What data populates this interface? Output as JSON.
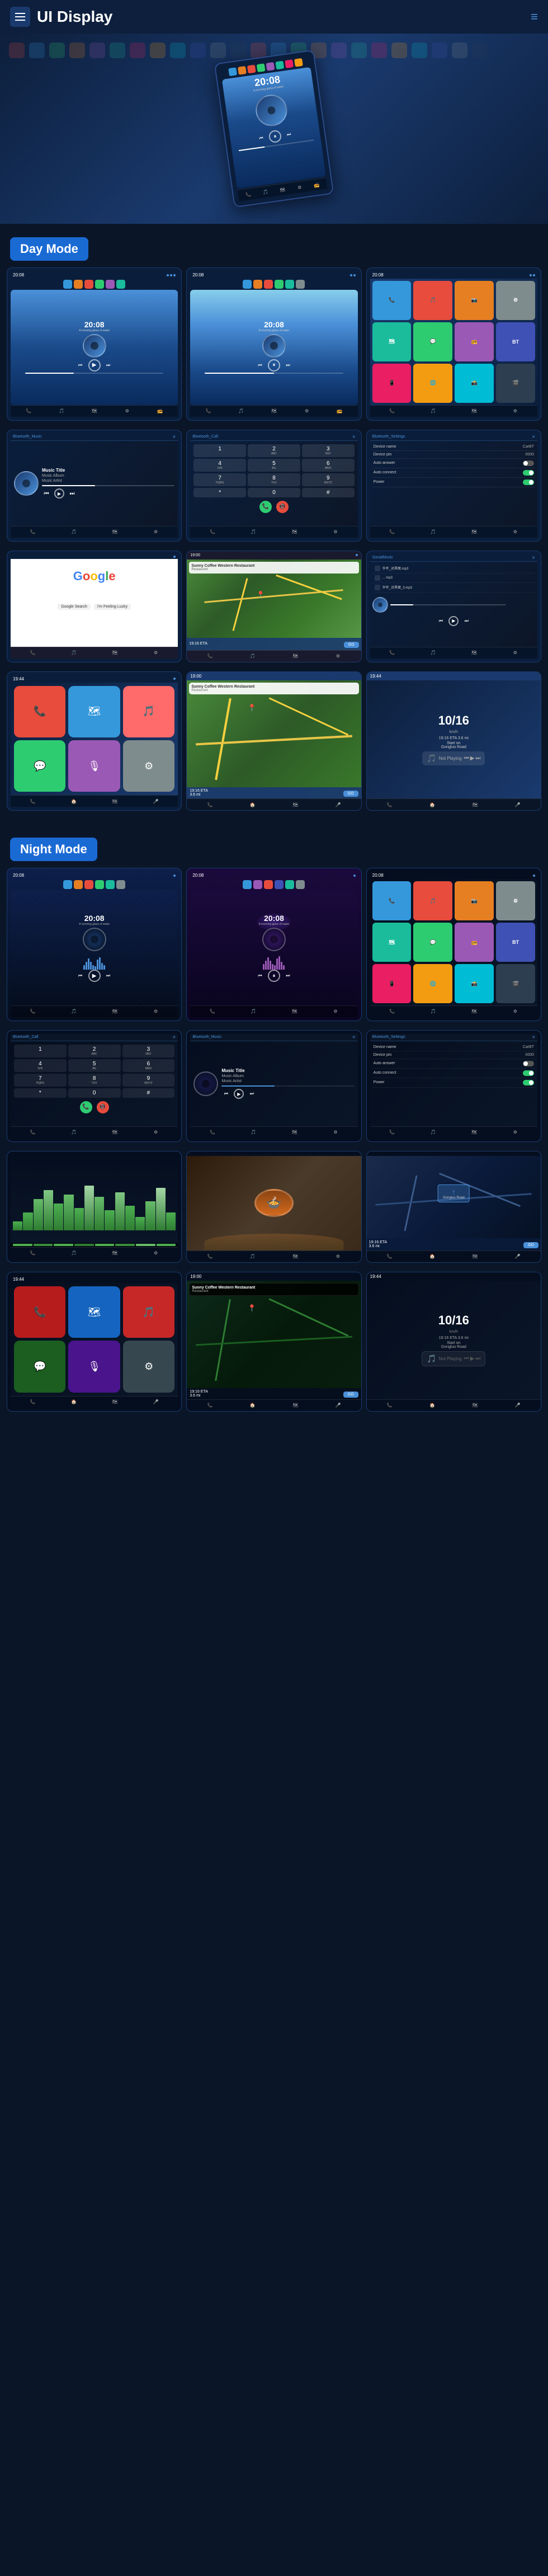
{
  "header": {
    "title": "UI Display",
    "menu_label": "menu",
    "nav_icon": "≡"
  },
  "day_mode": {
    "label": "Day Mode"
  },
  "night_mode": {
    "label": "Night Mode"
  },
  "screens": {
    "time": "20:08",
    "subtitle": "A morning glass of water",
    "music_title": "Music Title",
    "music_album": "Music Album",
    "music_artist": "Music Artist",
    "bluetooth_music": "Bluetooth_Music",
    "bluetooth_call": "Bluetooth_Call",
    "bluetooth_settings": "Bluetooth_Settings",
    "device_name_label": "Device name",
    "device_name_value": "CarBT",
    "device_pin_label": "Device pin",
    "device_pin_value": "0000",
    "auto_answer_label": "Auto answer",
    "auto_connect_label": "Auto connect",
    "power_label": "Power",
    "go_button": "GO",
    "destination": "Sunny Coffee Western Restaurant",
    "eta_label": "19:16 ETA",
    "time_label": "3.6 mi",
    "start_label": "Start on Gongluo Road",
    "not_playing": "Not Playing",
    "local_music_label": "SocialMusic",
    "dial_buttons": [
      "1",
      "2",
      "3",
      "4",
      "5",
      "6",
      "7",
      "8",
      "9",
      "*",
      "0",
      "#"
    ],
    "google_text": "Google",
    "speed_val": "10/16",
    "speed_eta": "19:16 ETA  3.6 mi"
  },
  "colors": {
    "accent": "#4a90d9",
    "day_label_bg": "#1a6ad4",
    "night_label_bg": "#1a6ad4",
    "bg_dark": "#0a1628",
    "card_bg": "#0a1e3c"
  }
}
